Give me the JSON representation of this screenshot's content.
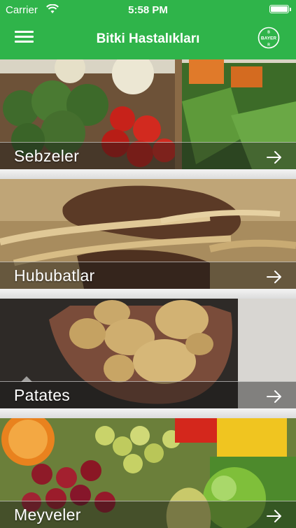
{
  "status_bar": {
    "carrier": "Carrier",
    "time": "5:58 PM"
  },
  "navbar": {
    "title": "Bitki Hastalıkları",
    "menu_icon": "hamburger-menu-icon",
    "logo": "bayer-cross-logo",
    "logo_text": "BAYER"
  },
  "colors": {
    "accent": "#2fb44a"
  },
  "categories": [
    {
      "label": "Sebzeler",
      "icon": "arrow-right-icon"
    },
    {
      "label": "Hububatlar",
      "icon": "arrow-right-icon"
    },
    {
      "label": "Patates",
      "icon": "arrow-right-icon"
    },
    {
      "label": "Meyveler",
      "icon": "arrow-right-icon"
    }
  ]
}
